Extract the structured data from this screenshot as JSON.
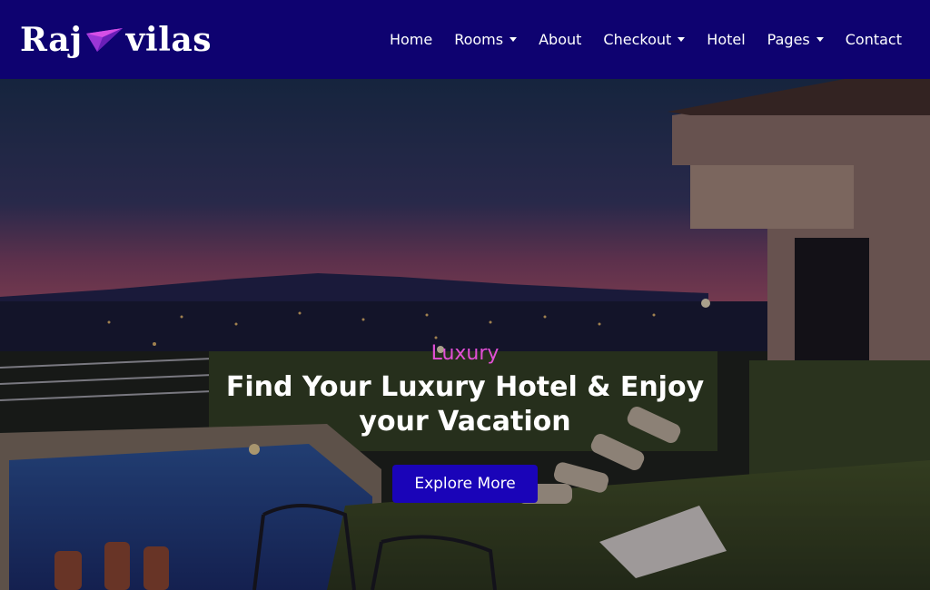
{
  "brand": {
    "part1": "Raj",
    "part2": "vilas"
  },
  "nav": {
    "items": [
      {
        "label": "Home"
      },
      {
        "label": "Rooms",
        "dropdown": true
      },
      {
        "label": "About"
      },
      {
        "label": "Checkout",
        "dropdown": true
      },
      {
        "label": "Hotel"
      },
      {
        "label": "Pages",
        "dropdown": true
      },
      {
        "label": "Contact"
      }
    ]
  },
  "hero": {
    "eyebrow": "Luxury",
    "headline_line1": "Find Your Luxury Hotel & Enjoy",
    "headline_line2": "your Vacation",
    "cta": "Explore More"
  },
  "colors": {
    "navbar": "#0e0270",
    "accent": "#e24fd6",
    "button": "#1a04b8"
  },
  "icons": [
    "paper-plane-logo-icon",
    "caret-down-icon"
  ]
}
